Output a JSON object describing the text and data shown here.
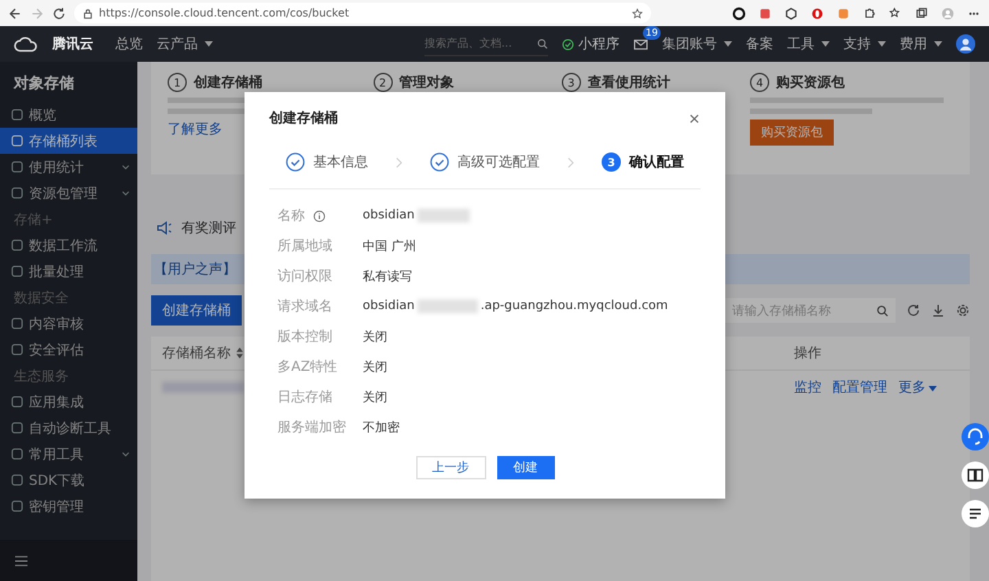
{
  "browser": {
    "url": "https://console.cloud.tencent.com/cos/bucket"
  },
  "top_nav": {
    "logo": "腾讯云",
    "links": [
      {
        "label": "总览",
        "dropdown": false
      },
      {
        "label": "云产品",
        "dropdown": true
      }
    ],
    "search": {
      "placeholder": "搜索产品、文档..."
    },
    "mini_program": "小程序",
    "mail_badge": "19",
    "menus": [
      {
        "label": "集团账号",
        "dropdown": true
      },
      {
        "label": "备案",
        "dropdown": false
      },
      {
        "label": "工具",
        "dropdown": true
      },
      {
        "label": "支持",
        "dropdown": true
      },
      {
        "label": "费用",
        "dropdown": true
      }
    ]
  },
  "sidebar": {
    "title": "对象存储",
    "items": [
      {
        "kind": "item",
        "label": "概览",
        "selected": false,
        "expandable": false
      },
      {
        "kind": "item",
        "label": "存储桶列表",
        "selected": true,
        "expandable": false
      },
      {
        "kind": "item",
        "label": "使用统计",
        "selected": false,
        "expandable": true
      },
      {
        "kind": "item",
        "label": "资源包管理",
        "selected": false,
        "expandable": true
      },
      {
        "kind": "section",
        "label": "存储+"
      },
      {
        "kind": "item",
        "label": "数据工作流",
        "selected": false,
        "expandable": false
      },
      {
        "kind": "item",
        "label": "批量处理",
        "selected": false,
        "expandable": false
      },
      {
        "kind": "section",
        "label": "数据安全"
      },
      {
        "kind": "item",
        "label": "内容审核",
        "selected": false,
        "expandable": false
      },
      {
        "kind": "item",
        "label": "安全评估",
        "selected": false,
        "expandable": false
      },
      {
        "kind": "section",
        "label": "生态服务"
      },
      {
        "kind": "item",
        "label": "应用集成",
        "selected": false,
        "expandable": false
      },
      {
        "kind": "item",
        "label": "自动诊断工具",
        "selected": false,
        "expandable": false
      },
      {
        "kind": "item",
        "label": "常用工具",
        "selected": false,
        "expandable": true
      },
      {
        "kind": "item",
        "label": "SDK下载",
        "selected": false,
        "expandable": false
      },
      {
        "kind": "item",
        "label": "密钥管理",
        "selected": false,
        "expandable": false
      }
    ]
  },
  "guide_steps": [
    {
      "number": "1",
      "title": "创建存储桶",
      "link": "了解更多"
    },
    {
      "number": "2",
      "title": "管理对象"
    },
    {
      "number": "3",
      "title": "查看使用统计"
    },
    {
      "number": "4",
      "title": "购买资源包",
      "button": "购买资源包"
    }
  ],
  "notice": "有奖测评",
  "banner": "【用户之声】",
  "toolbar": {
    "create_button": "创建存储桶",
    "search": {
      "placeholder": "请输入存储桶名称"
    }
  },
  "table": {
    "columns": [
      "存储桶名称",
      "操作"
    ],
    "rows": [
      {
        "actions": [
          {
            "label": "监控",
            "dropdown": false
          },
          {
            "label": "配置管理",
            "dropdown": false
          },
          {
            "label": "更多",
            "dropdown": true
          }
        ]
      }
    ]
  },
  "dialog": {
    "title": "创建存储桶",
    "steps": [
      {
        "label": "基本信息",
        "done": true,
        "selected": false
      },
      {
        "label": "高级可选配置",
        "done": true,
        "selected": false
      },
      {
        "number": "3",
        "label": "确认配置",
        "done": false,
        "selected": true
      }
    ],
    "fields": [
      {
        "label": "名称",
        "info": true,
        "value": "obsidian",
        "redacted": true
      },
      {
        "label": "所属地域",
        "value": "中国 广州"
      },
      {
        "label": "访问权限",
        "value": "私有读写"
      },
      {
        "label": "请求域名",
        "value": "obsidian",
        "redacted": true,
        "suffix": ".ap-guangzhou.myqcloud.com"
      },
      {
        "label": "版本控制",
        "value": "关闭"
      },
      {
        "label": "多AZ特性",
        "value": "关闭"
      },
      {
        "label": "日志存储",
        "value": "关闭"
      },
      {
        "label": "服务端加密",
        "value": "不加密"
      }
    ],
    "buttons": [
      {
        "label": "上一步",
        "primary": false
      },
      {
        "label": "创建",
        "primary": true
      }
    ]
  }
}
